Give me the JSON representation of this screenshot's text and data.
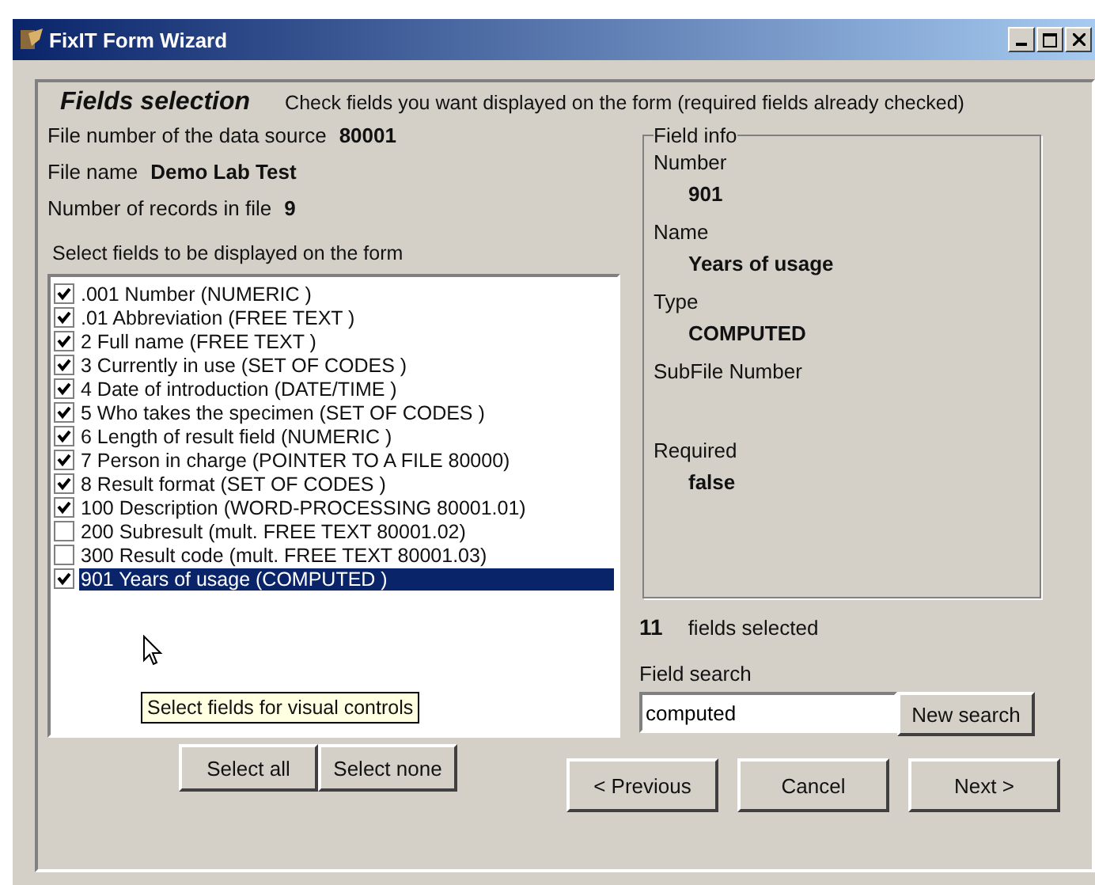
{
  "window": {
    "title": "FixIT Form Wizard"
  },
  "header": {
    "title": "Fields selection",
    "hint": "Check fields you want displayed on the form (required fields already checked)"
  },
  "file_info": [
    {
      "label": "File number of the data source",
      "value": "80001"
    },
    {
      "label": "File name",
      "value": "Demo Lab Test"
    },
    {
      "label": "Number of records in file",
      "value": "9"
    }
  ],
  "list_label": "Select fields to be displayed on the form",
  "fields": [
    {
      "text": ".001  Number (NUMERIC )",
      "checked": true,
      "selected": false
    },
    {
      "text": ".01  Abbreviation (FREE TEXT )",
      "checked": true,
      "selected": false
    },
    {
      "text": "2  Full name (FREE TEXT )",
      "checked": true,
      "selected": false
    },
    {
      "text": "3  Currently in use (SET OF CODES )",
      "checked": true,
      "selected": false
    },
    {
      "text": "4  Date of introduction (DATE/TIME )",
      "checked": true,
      "selected": false
    },
    {
      "text": "5  Who takes the specimen (SET OF CODES )",
      "checked": true,
      "selected": false
    },
    {
      "text": "6  Length of result field (NUMERIC )",
      "checked": true,
      "selected": false
    },
    {
      "text": "7  Person in charge (POINTER TO A FILE 80000)",
      "checked": true,
      "selected": false
    },
    {
      "text": "8  Result format (SET OF CODES )",
      "checked": true,
      "selected": false
    },
    {
      "text": "100  Description (WORD-PROCESSING 80001.01)",
      "checked": true,
      "selected": false
    },
    {
      "text": "200  Subresult (mult. FREE TEXT 80001.02)",
      "checked": false,
      "selected": false
    },
    {
      "text": "300  Result code (mult. FREE TEXT 80001.03)",
      "checked": false,
      "selected": false
    },
    {
      "text": "901  Years of usage (COMPUTED )",
      "checked": true,
      "selected": true
    }
  ],
  "tooltip": "Select fields for visual controls",
  "list_buttons": [
    "Select all",
    "Select none"
  ],
  "field_info": {
    "title": "Field info",
    "entries": [
      {
        "label": "Number",
        "value": "901"
      },
      {
        "label": "Name",
        "value": "Years of usage"
      },
      {
        "label": "Type",
        "value": "COMPUTED"
      },
      {
        "label": "SubFile Number"
      },
      {
        "label": "Required",
        "value": "false"
      }
    ]
  },
  "selected_count": {
    "count": "11",
    "label": "fields selected"
  },
  "search": {
    "label": "Field search",
    "value": "computed",
    "button": "New search"
  },
  "nav_buttons": [
    "< Previous",
    "Cancel",
    "Next >"
  ]
}
